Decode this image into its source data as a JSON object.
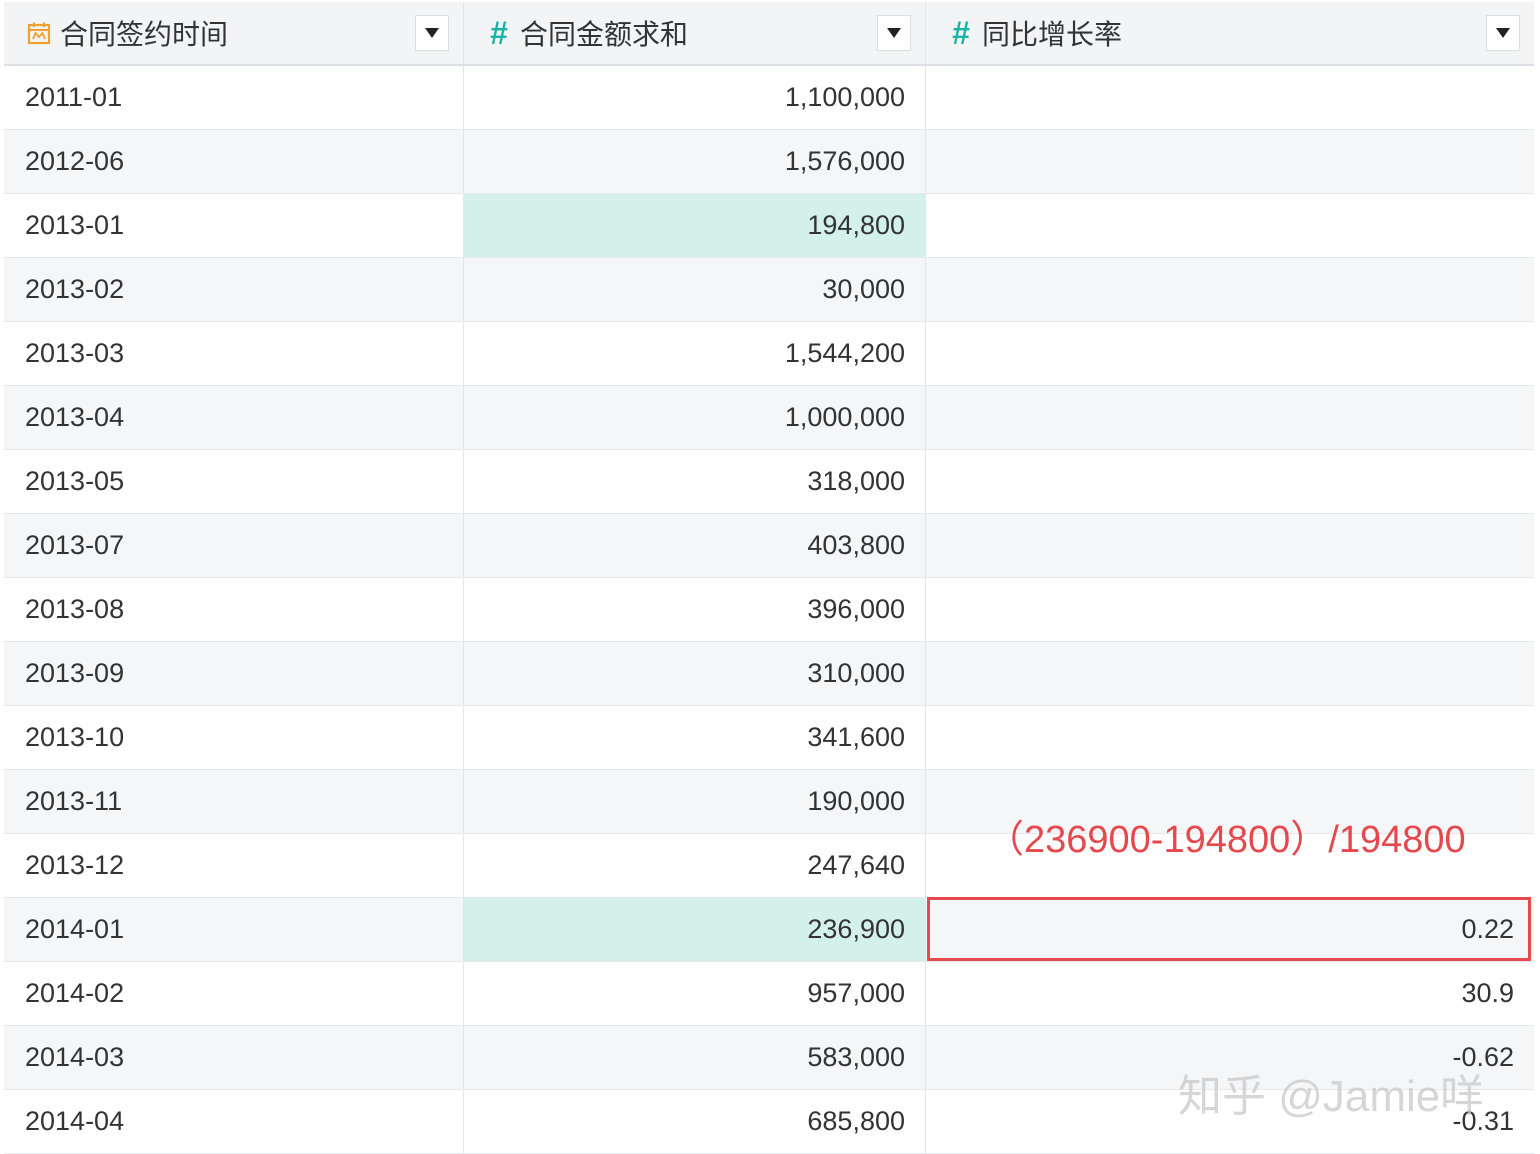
{
  "columns": [
    {
      "label": "合同签约时间",
      "type_icon": "calendar-icon",
      "dropdown_icon": "caret-down-icon"
    },
    {
      "label": "合同金额求和",
      "type_icon": "#",
      "dropdown_icon": "caret-down-icon"
    },
    {
      "label": "同比增长率",
      "type_icon": "#",
      "dropdown_icon": "caret-down-icon"
    }
  ],
  "rows": [
    {
      "date": "2011-01",
      "amount": "1,100,000",
      "growth": ""
    },
    {
      "date": "2012-06",
      "amount": "1,576,000",
      "growth": ""
    },
    {
      "date": "2013-01",
      "amount": "194,800",
      "growth": ""
    },
    {
      "date": "2013-02",
      "amount": "30,000",
      "growth": ""
    },
    {
      "date": "2013-03",
      "amount": "1,544,200",
      "growth": ""
    },
    {
      "date": "2013-04",
      "amount": "1,000,000",
      "growth": ""
    },
    {
      "date": "2013-05",
      "amount": "318,000",
      "growth": ""
    },
    {
      "date": "2013-07",
      "amount": "403,800",
      "growth": ""
    },
    {
      "date": "2013-08",
      "amount": "396,000",
      "growth": ""
    },
    {
      "date": "2013-09",
      "amount": "310,000",
      "growth": ""
    },
    {
      "date": "2013-10",
      "amount": "341,600",
      "growth": ""
    },
    {
      "date": "2013-11",
      "amount": "190,000",
      "growth": ""
    },
    {
      "date": "2013-12",
      "amount": "247,640",
      "growth": ""
    },
    {
      "date": "2014-01",
      "amount": "236,900",
      "growth": "0.22"
    },
    {
      "date": "2014-02",
      "amount": "957,000",
      "growth": "30.9"
    },
    {
      "date": "2014-03",
      "amount": "583,000",
      "growth": "-0.62"
    },
    {
      "date": "2014-04",
      "amount": "685,800",
      "growth": "-0.31"
    }
  ],
  "annotation": "（236900-194800）/194800",
  "watermark": "知乎 @Jamie咩",
  "colors": {
    "highlight": "#d4f0ea",
    "annotation": "#e5484d",
    "numeric_icon": "#19b4a4",
    "date_icon": "#f0a030"
  }
}
